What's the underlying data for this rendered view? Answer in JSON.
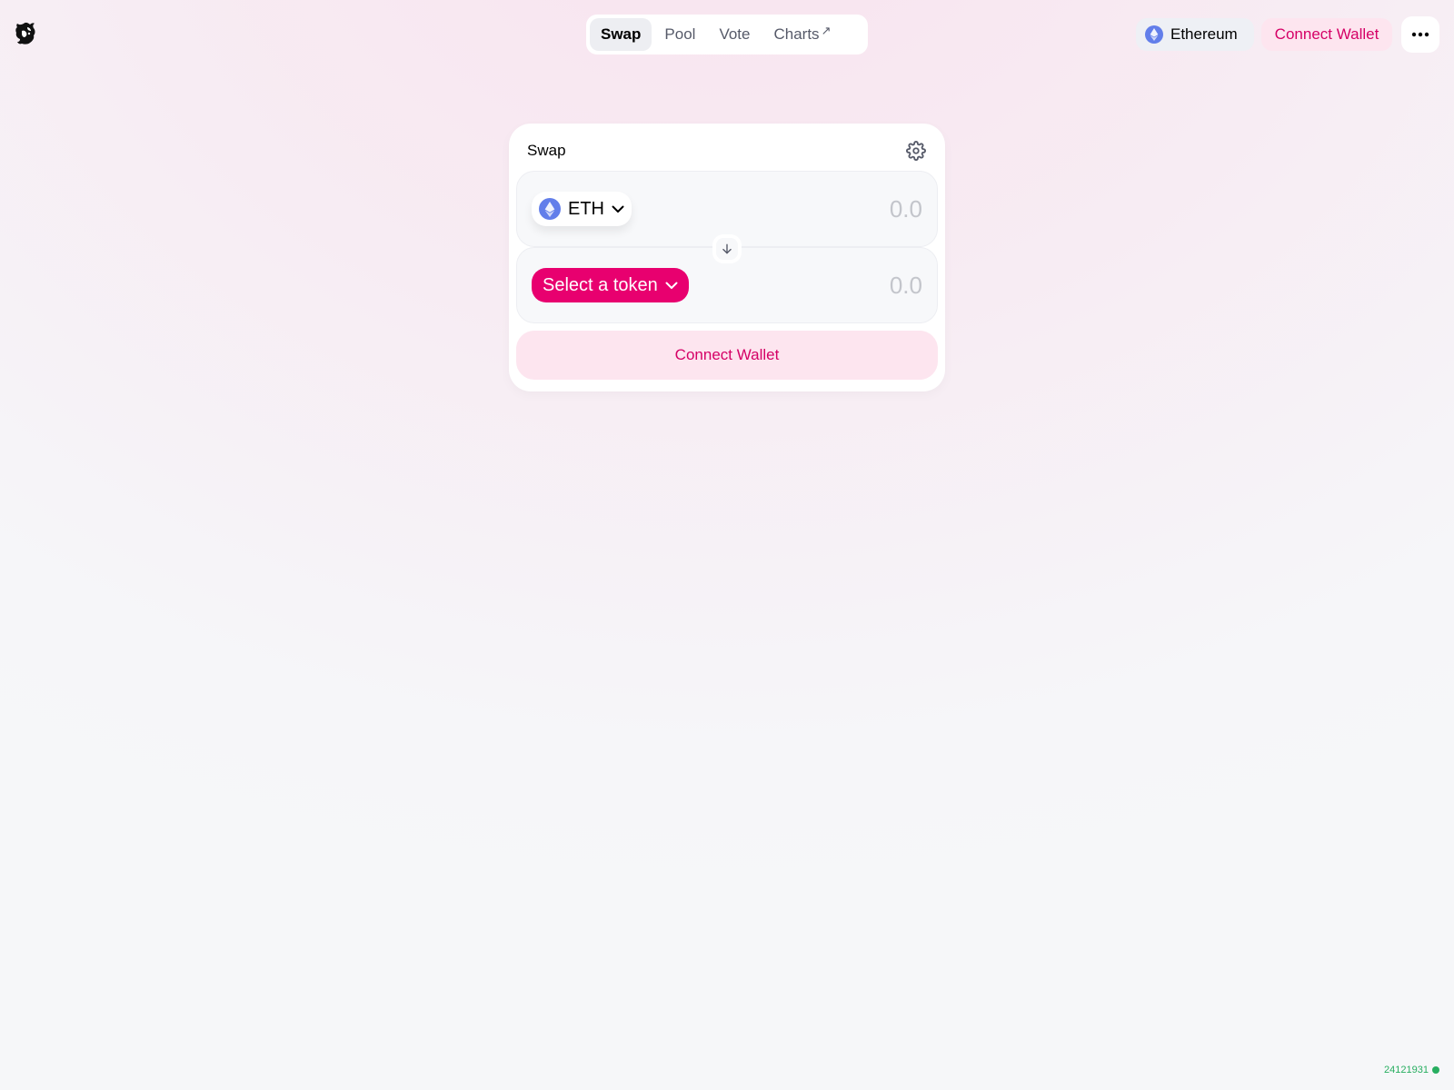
{
  "nav": {
    "tabs": [
      {
        "label": "Swap",
        "active": true
      },
      {
        "label": "Pool",
        "active": false
      },
      {
        "label": "Vote",
        "active": false
      },
      {
        "label": "Charts",
        "active": false,
        "external_icon": "↗"
      }
    ]
  },
  "header": {
    "network_label": "Ethereum",
    "connect_label": "Connect Wallet",
    "more_icon": "ellipsis-icon"
  },
  "swap": {
    "title": "Swap",
    "settings_icon": "gear-icon",
    "input": {
      "token": "ETH",
      "placeholder": "0.0",
      "value": ""
    },
    "output": {
      "token_button": "Select a token",
      "placeholder": "0.0",
      "value": ""
    },
    "connect_label": "Connect Wallet"
  },
  "footer": {
    "block_number": "24121931"
  },
  "colors": {
    "accent": "#e8006f",
    "accent_text": "#d50066",
    "accent_soft": "#fde5ef",
    "eth_blue": "#627eea",
    "status_green": "#27ae60"
  }
}
